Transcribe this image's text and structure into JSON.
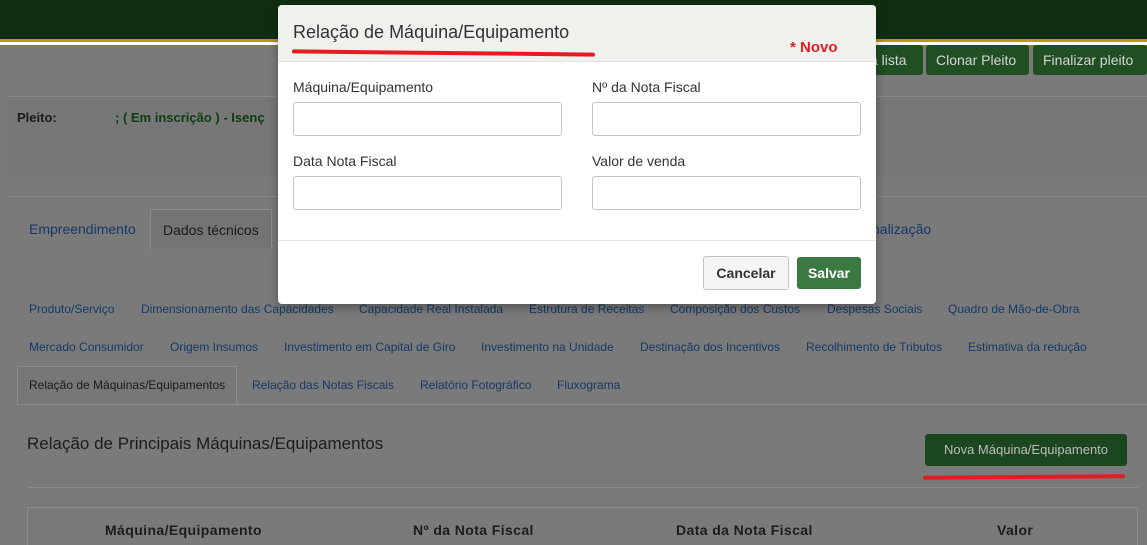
{
  "header": {
    "buttons": [
      "a lista",
      "Clonar Pleito",
      "Finalizar pleito"
    ]
  },
  "pleito": {
    "label": "Pleito:",
    "value": "; ( Em inscrição ) - Isenç"
  },
  "main_tabs": [
    {
      "label": "Empreendimento",
      "active": false
    },
    {
      "label": "Dados técnicos",
      "active": true
    },
    {
      "label": "nalização",
      "active": false
    }
  ],
  "sub_tabs_row1": [
    "Produto/Serviço",
    "Dimensionamento das Capacidades",
    "Capacidade Real Instalada",
    "Estrutura de Receitas",
    "Composição dos Custos",
    "Despesas Sociais",
    "Quadro de Mão-de-Obra"
  ],
  "sub_tabs_row2": [
    "Mercado Consumidor",
    "Origem Insumos",
    "Investimento em Capital de Giro",
    "Investimento na Unidade",
    "Destinação dos Incentivos",
    "Recolhimento de Tributos",
    "Estimativa da redução"
  ],
  "sub_tabs_row3": [
    "Relação de Máquinas/Equipamentos",
    "Relação das Notas Fiscais",
    "Relatório Fotográfico",
    "Fluxograma"
  ],
  "section": {
    "title": "Relação de Principais Máquinas/Equipamentos",
    "new_button": "Nova Máquina/Equipamento",
    "columns": [
      "Máquina/Equipamento",
      "Nº da Nota Fiscal",
      "Data da Nota Fiscal",
      "Valor"
    ]
  },
  "modal": {
    "title": "Relação de Máquina/Equipamento",
    "annotation": "* Novo",
    "fields": {
      "machine": {
        "label": "Máquina/Equipamento",
        "value": ""
      },
      "invoice_no": {
        "label": "Nº da Nota Fiscal",
        "value": ""
      },
      "invoice_date": {
        "label": "Data Nota Fiscal",
        "value": ""
      },
      "sale_value": {
        "label": "Valor de venda",
        "value": ""
      }
    },
    "cancel_label": "Cancelar",
    "save_label": "Salvar"
  },
  "colors": {
    "topbar": "#0f2e10",
    "accent_gold": "#b79a16",
    "annotation_red": "#e31b23",
    "save_green": "#3a7a42"
  }
}
